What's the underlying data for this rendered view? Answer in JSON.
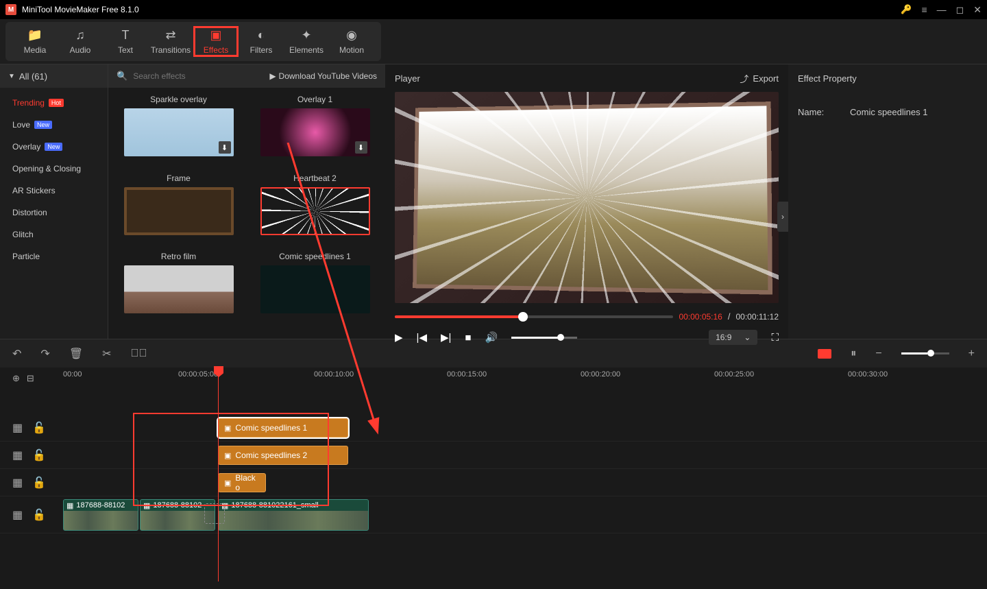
{
  "app": {
    "title": "MiniTool MovieMaker Free 8.1.0"
  },
  "tabs": {
    "media": "Media",
    "audio": "Audio",
    "text": "Text",
    "transitions": "Transitions",
    "effects": "Effects",
    "filters": "Filters",
    "elements": "Elements",
    "motion": "Motion"
  },
  "sidebar": {
    "all_label": "All (61)",
    "items": [
      {
        "label": "Trending",
        "badge": "Hot"
      },
      {
        "label": "Love",
        "badge": "New"
      },
      {
        "label": "Overlay",
        "badge": "New"
      },
      {
        "label": "Opening & Closing"
      },
      {
        "label": "AR Stickers"
      },
      {
        "label": "Distortion"
      },
      {
        "label": "Glitch"
      },
      {
        "label": "Particle"
      }
    ]
  },
  "search": {
    "placeholder": "Search effects",
    "download_label": "Download YouTube Videos"
  },
  "effects": {
    "row1": [
      "Sparkle overlay",
      "Overlay 1"
    ],
    "row2": [
      "Frame",
      "Heartbeat 2"
    ],
    "row3": [
      "Retro film",
      "Comic speedlines 1"
    ]
  },
  "player": {
    "title": "Player",
    "export_label": "Export",
    "time_current": "00:00:05:16",
    "time_total": "00:00:11:12",
    "aspect": "16:9"
  },
  "property": {
    "header": "Effect Property",
    "name_label": "Name:",
    "name_value": "Comic speedlines 1"
  },
  "ruler": [
    "00:00",
    "00:00:05:00",
    "00:00:10:00",
    "00:00:15:00",
    "00:00:20:00",
    "00:00:25:00",
    "00:00:30:00"
  ],
  "clips": {
    "effect1": "Comic speedlines 1",
    "effect2": "Comic speedlines 2",
    "effect3": "Black o",
    "video1": "187688-88102",
    "video2": "187688-88102",
    "video3": "187688-881022161_small"
  }
}
